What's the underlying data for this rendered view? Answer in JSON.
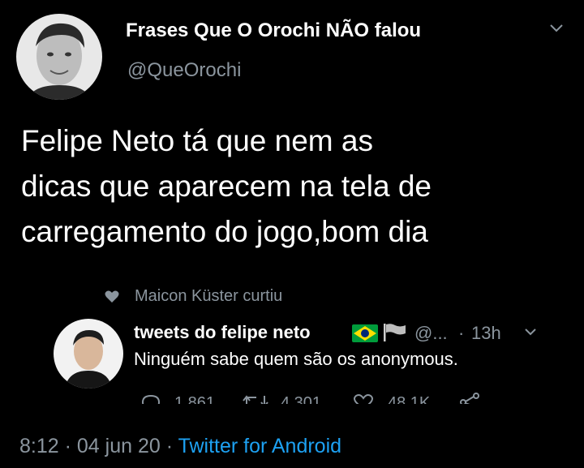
{
  "tweet": {
    "display_name": "Frases Que O Orochi NÃO falou",
    "handle": "@QueOrochi",
    "text_lines": [
      "Felipe Neto tá que nem as",
      "dicas que aparecem na tela de",
      "carregamento do jogo,bom dia"
    ],
    "time": "8:12",
    "date": "04 jun 20",
    "client": "Twitter for Android",
    "separator": "·"
  },
  "embedded": {
    "liked_by": "Maicon Küster curtiu",
    "display_name": "tweets do felipe neto",
    "handle": "@...",
    "age": "13h",
    "text": "Ninguém sabe quem são os anonymous.",
    "replies": "1.861",
    "retweets": "4.301",
    "likes": "48,1K",
    "separator": "·"
  },
  "colors": {
    "background": "#000000",
    "text": "#ffffff",
    "muted": "#8b959e",
    "link": "#1da1f2"
  },
  "icons": [
    "chevron-down-icon",
    "heart-icon",
    "brazil-flag-icon",
    "flag-icon",
    "reply-icon",
    "retweet-icon",
    "like-icon",
    "share-icon"
  ]
}
